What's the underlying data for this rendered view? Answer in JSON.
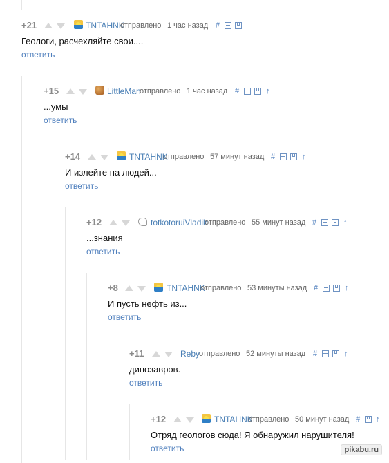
{
  "comments": [
    {
      "rating": "+21",
      "nick": "TNTAHNK",
      "sent": "отправлено",
      "time": "1 час назад",
      "text": "Геологи, расчехляйте свои....",
      "reply": "ответить",
      "avatar": "sunset-avatar-icon",
      "hash": "#",
      "up": ""
    },
    {
      "rating": "+15",
      "nick": "LittleMan",
      "sent": "отправлено",
      "time": "1 час назад",
      "text": "...умы",
      "reply": "ответить",
      "avatar": "brown-avatar-icon",
      "hash": "#",
      "up": "↑"
    },
    {
      "rating": "+14",
      "nick": "TNTAHNK",
      "sent": "отправлено",
      "time": "57 минут назад",
      "text": "И излейте на людей...",
      "reply": "ответить",
      "avatar": "sunset-avatar-icon",
      "hash": "#",
      "up": "↑"
    },
    {
      "rating": "+12",
      "nick": "totkotoruiVladik",
      "sent": "отправлено",
      "time": "55 минут назад",
      "text": "...знания",
      "reply": "ответить",
      "avatar": "heart-avatar-icon",
      "hash": "#",
      "up": "↑"
    },
    {
      "rating": "+8",
      "nick": "TNTAHNK",
      "sent": "отправлено",
      "time": "53 минуты назад",
      "text": "И пусть нефть из...",
      "reply": "ответить",
      "avatar": "sunset-avatar-icon",
      "hash": "#",
      "up": "↑"
    },
    {
      "rating": "+11",
      "nick": "Reby",
      "sent": "отправлено",
      "time": "52 минуты назад",
      "text": "динозавров.",
      "reply": "ответить",
      "avatar": "",
      "hash": "#",
      "up": "↑"
    },
    {
      "rating": "+12",
      "nick": "TNTAHNK",
      "sent": "отправлено",
      "time": "50 минут назад",
      "text": "Отряд геологов сюда! Я обнаружил нарушителя!",
      "reply": "ответить",
      "avatar": "sunset-avatar-icon",
      "hash": "#",
      "up": "↑"
    }
  ],
  "watermark": "pikabu.ru"
}
